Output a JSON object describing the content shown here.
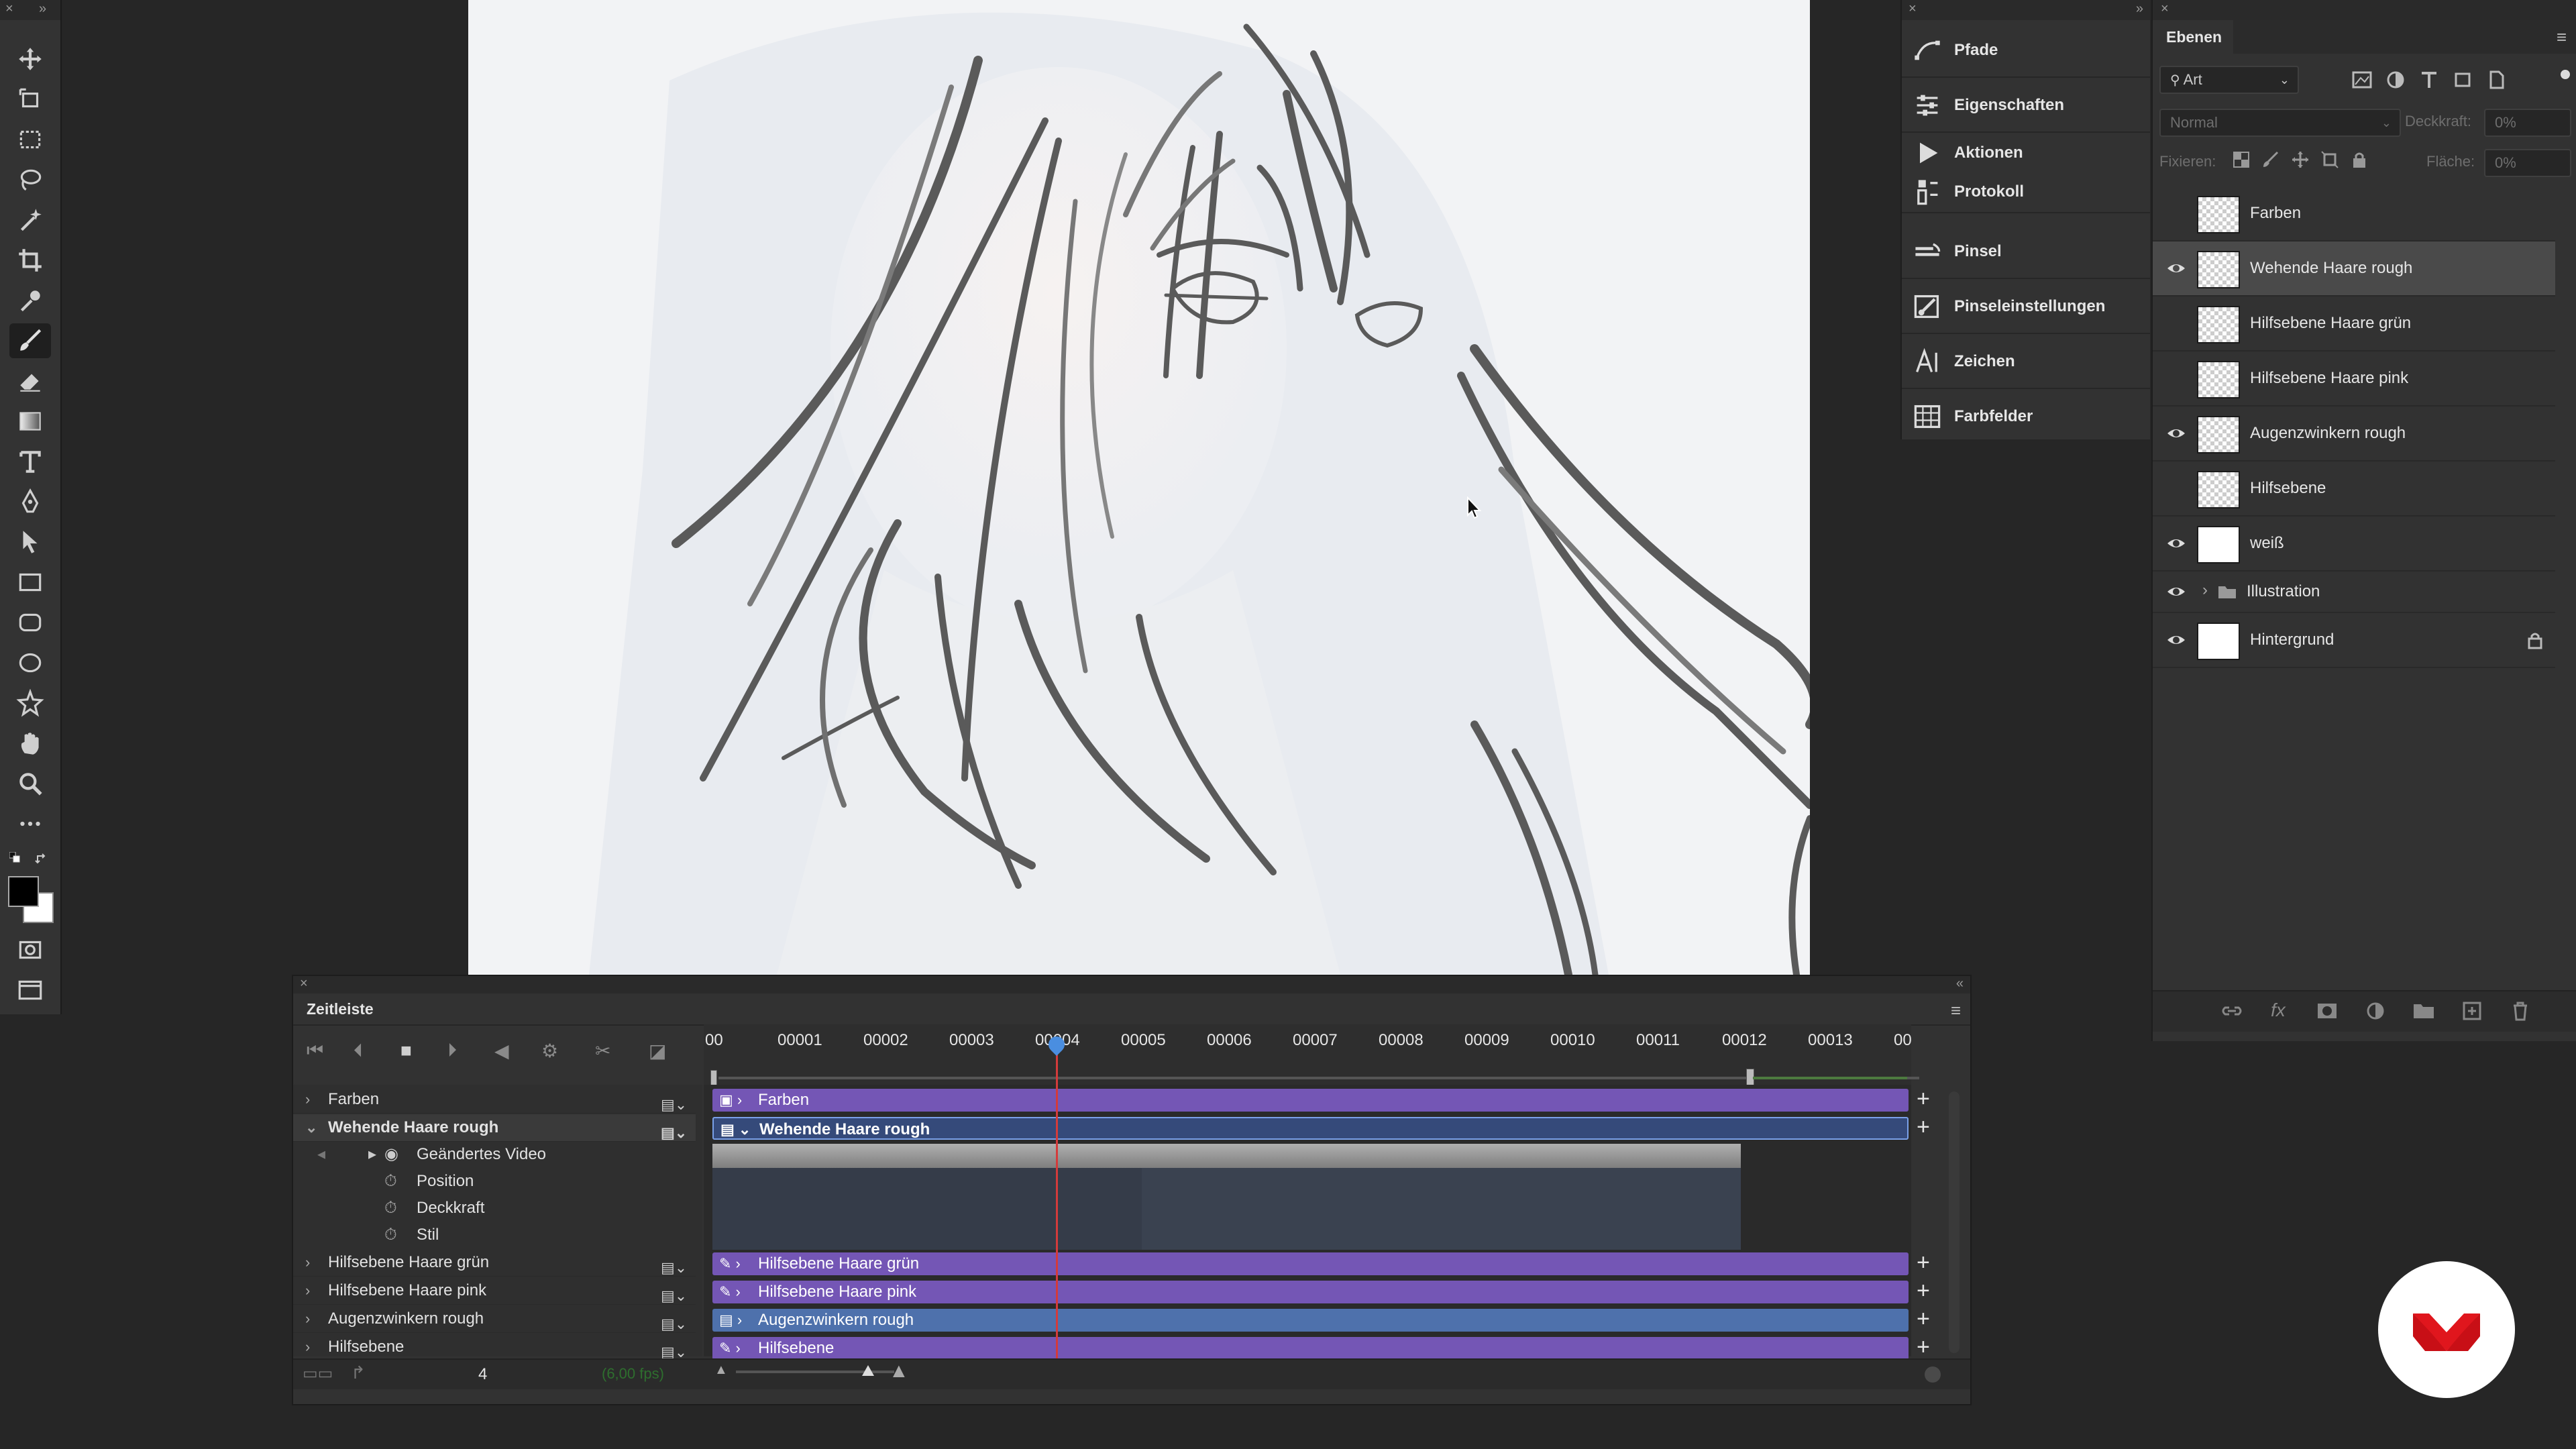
{
  "canvas": {
    "background": "#f2f3f5"
  },
  "toolbar": {
    "tools": [
      "move-icon",
      "artboard-icon",
      "marquee-icon",
      "lasso-icon",
      "magic-wand-icon",
      "crop-icon",
      "eyedropper-icon",
      "brush-icon",
      "eraser-icon",
      "gradient-icon",
      "type-icon",
      "pen-icon",
      "path-select-icon",
      "rectangle-icon",
      "rounded-rect-icon",
      "ellipse-icon",
      "custom-shape-icon",
      "hand-icon",
      "zoom-icon",
      "more-icon"
    ],
    "active_tool": "brush-icon"
  },
  "dock": {
    "items": [
      {
        "label": "Pfade",
        "icon": "paths-icon"
      },
      {
        "label": "Eigenschaften",
        "icon": "properties-icon"
      },
      {
        "label": "Aktionen",
        "icon": "actions-icon"
      },
      {
        "label": "Protokoll",
        "icon": "history-icon"
      },
      {
        "label": "Pinsel",
        "icon": "brush-panel-icon"
      },
      {
        "label": "Pinseleinstellungen",
        "icon": "brush-settings-icon"
      },
      {
        "label": "Zeichen",
        "icon": "character-icon"
      },
      {
        "label": "Farbfelder",
        "icon": "swatches-icon"
      }
    ]
  },
  "layers_panel": {
    "tab": "Ebenen",
    "filter_kind": "Art",
    "blend_mode": "Normal",
    "opacity_label": "Deckkraft:",
    "opacity_value": "0%",
    "lock_label": "Fixieren:",
    "fill_label": "Fläche:",
    "fill_value": "0%",
    "layers": [
      {
        "name": "Farben",
        "visible": false,
        "selected": false,
        "thumb": "check"
      },
      {
        "name": "Wehende Haare rough",
        "visible": true,
        "selected": true,
        "thumb": "check"
      },
      {
        "name": "Hilfsebene Haare grün",
        "visible": false,
        "selected": false,
        "thumb": "check"
      },
      {
        "name": "Hilfsebene Haare pink",
        "visible": false,
        "selected": false,
        "thumb": "check"
      },
      {
        "name": "Augenzwinkern rough",
        "visible": true,
        "selected": false,
        "thumb": "check"
      },
      {
        "name": "Hilfsebene",
        "visible": false,
        "selected": false,
        "thumb": "check"
      },
      {
        "name": "weiß",
        "visible": true,
        "selected": false,
        "thumb": "white"
      },
      {
        "name": "Illustration",
        "visible": true,
        "selected": false,
        "thumb": "group"
      },
      {
        "name": "Hintergrund",
        "visible": true,
        "selected": false,
        "thumb": "white",
        "locked": true
      }
    ]
  },
  "timeline": {
    "title": "Zeitleiste",
    "ticks": [
      "00",
      "00001",
      "00002",
      "00003",
      "00004",
      "00005",
      "00006",
      "00007",
      "00008",
      "00009",
      "00010",
      "00011",
      "00012",
      "00013",
      "00"
    ],
    "current_frame": "4",
    "fps": "(6,00 fps)",
    "tracks": [
      {
        "label": "Farben",
        "clip": "Farben",
        "color": "purple",
        "expanded": false
      },
      {
        "label": "Wehende Haare rough",
        "clip": "Wehende Haare rough",
        "color": "selected",
        "expanded": true,
        "properties": [
          "Geändertes Video",
          "Position",
          "Deckkraft",
          "Stil"
        ]
      },
      {
        "label": "Hilfsebene Haare grün",
        "clip": "Hilfsebene Haare grün",
        "color": "purple",
        "expanded": false
      },
      {
        "label": "Hilfsebene Haare pink",
        "clip": "Hilfsebene Haare pink",
        "color": "purple",
        "expanded": false
      },
      {
        "label": "Augenzwinkern rough",
        "clip": "Augenzwinkern rough",
        "color": "blue",
        "expanded": false
      },
      {
        "label": "Hilfsebene",
        "clip": "Hilfsebene",
        "color": "purple",
        "expanded": false
      }
    ]
  }
}
